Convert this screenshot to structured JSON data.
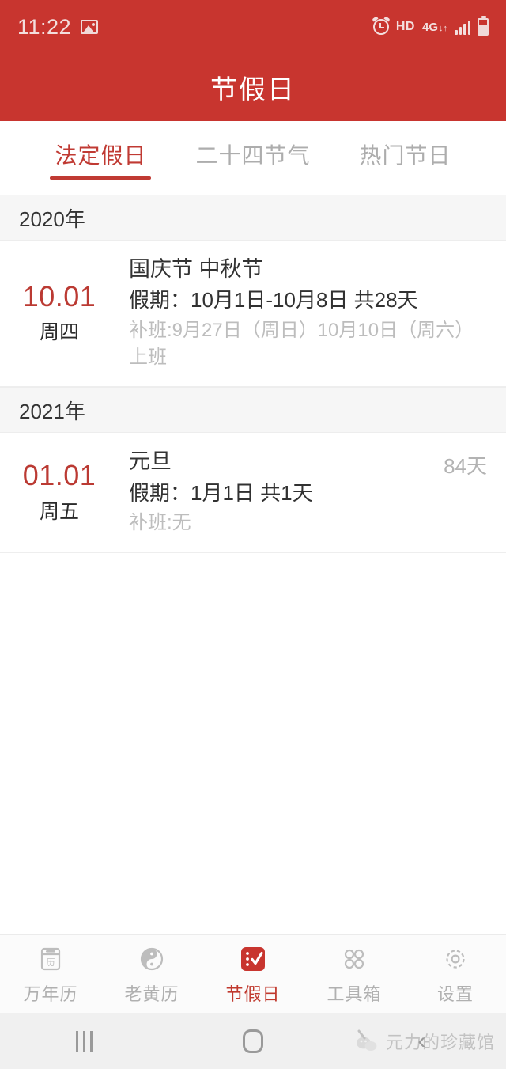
{
  "status_bar": {
    "time": "11:22",
    "left_icons": [
      {
        "name": "screenshot-photo-icon"
      }
    ],
    "right_icons": [
      {
        "name": "alarm-icon"
      },
      {
        "name": "hd-icon",
        "label": "HD"
      },
      {
        "name": "network-4g-icon",
        "label": "4G",
        "arrows": "↓↑"
      },
      {
        "name": "signal-bars-icon"
      },
      {
        "name": "battery-icon"
      }
    ],
    "background_color": "#c8352f"
  },
  "app_bar": {
    "title": "节假日",
    "background_color": "#c8352f",
    "title_color": "#ffffff"
  },
  "tabs": {
    "active_index": 0,
    "active_color": "#c03a33",
    "inactive_color": "#adadad",
    "items": [
      {
        "label": "法定假日"
      },
      {
        "label": "二十四节气"
      },
      {
        "label": "热门节日"
      }
    ]
  },
  "list": {
    "sections": [
      {
        "header": "2020年",
        "rows": [
          {
            "date": "10.01",
            "weekday": "周四",
            "name": "国庆节 中秋节",
            "period": "假期：10月1日-10月8日 共28天",
            "makeup": "补班:9月27日（周日）10月10日（周六）上班",
            "countdown": ""
          }
        ]
      },
      {
        "header": "2021年",
        "rows": [
          {
            "date": "01.01",
            "weekday": "周五",
            "name": "元旦",
            "period": "假期：1月1日 共1天",
            "makeup": "补班:无",
            "countdown": "84天"
          }
        ]
      }
    ]
  },
  "bottom_nav": {
    "active_index": 2,
    "active_color": "#c0392e",
    "inactive_color": "#b0b0b0",
    "items": [
      {
        "label": "万年历",
        "icon": "almanac-calendar-icon"
      },
      {
        "label": "老黄历",
        "icon": "yinyang-icon"
      },
      {
        "label": "节假日",
        "icon": "checklist-icon"
      },
      {
        "label": "工具箱",
        "icon": "grid-apps-icon"
      },
      {
        "label": "设置",
        "icon": "gear-icon"
      }
    ]
  },
  "android_nav": {
    "recents": "recents-icon",
    "home": "home-icon",
    "back": "‹",
    "watermark_text": "元力的珍藏馆"
  }
}
